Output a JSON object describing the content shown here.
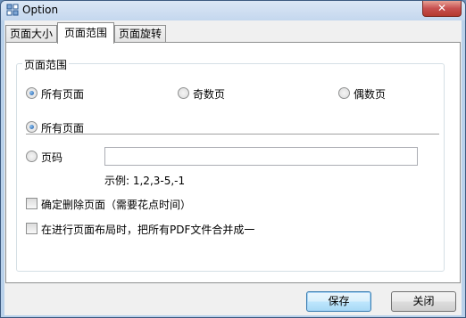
{
  "window": {
    "title": "Option",
    "close_glyph": "✕"
  },
  "tabs": [
    {
      "label": "页面大小",
      "active": false
    },
    {
      "label": "页面范围",
      "active": true
    },
    {
      "label": "页面旋转",
      "active": false
    }
  ],
  "page_range": {
    "group_title": "页面范围",
    "filter_options": [
      {
        "label": "所有页面",
        "checked": true
      },
      {
        "label": "奇数页",
        "checked": false
      },
      {
        "label": "偶数页",
        "checked": false
      }
    ],
    "range_options": [
      {
        "label": "所有页面",
        "checked": true
      },
      {
        "label": "页码",
        "checked": false
      }
    ],
    "page_number_value": "",
    "example_text": "示例: 1,2,3-5,-1",
    "checkboxes": [
      {
        "label": "确定删除页面（需要花点时间）",
        "checked": false
      },
      {
        "label": "在进行页面布局时，把所有PDF文件合并成一个",
        "checked": false
      }
    ]
  },
  "buttons": {
    "save": "保存",
    "close": "关闭"
  }
}
